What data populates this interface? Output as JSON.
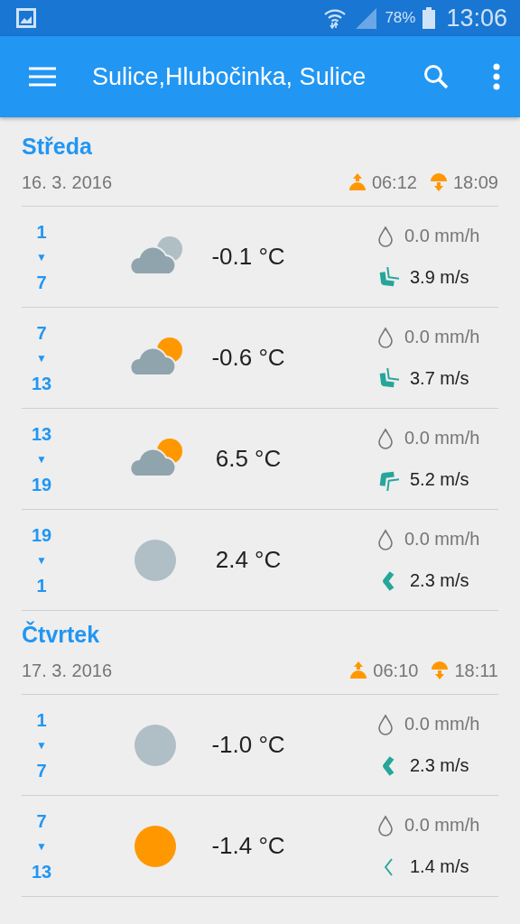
{
  "status_bar": {
    "battery": "78%",
    "time": "13:06"
  },
  "toolbar": {
    "title": "Sulice,Hlubočinka, Sulice"
  },
  "days": [
    {
      "name": "Středa",
      "date": "16. 3. 2016",
      "sunrise": "06:12",
      "sunset": "18:09",
      "rows": [
        {
          "from": "1",
          "arrow": "▼",
          "to": "7",
          "sky": {
            "kind": "cloud-moon"
          },
          "temp": "-0.1 °C",
          "rain": "0.0 mm/h",
          "wind": "3.9 m/s",
          "wind_icon": {
            "kind": "sw-moderate"
          }
        },
        {
          "from": "7",
          "arrow": "▼",
          "to": "13",
          "sky": {
            "kind": "cloud-sun"
          },
          "temp": "-0.6 °C",
          "rain": "0.0 mm/h",
          "wind": "3.7 m/s",
          "wind_icon": {
            "kind": "sw-moderate"
          }
        },
        {
          "from": "13",
          "arrow": "▼",
          "to": "19",
          "sky": {
            "kind": "cloud-sun"
          },
          "temp": "6.5 °C",
          "rain": "0.0 mm/h",
          "wind": "5.2 m/s",
          "wind_icon": {
            "kind": "nw-moderate"
          }
        },
        {
          "from": "19",
          "arrow": "▼",
          "to": "1",
          "sky": {
            "kind": "moon"
          },
          "temp": "2.4 °C",
          "rain": "0.0 mm/h",
          "wind": "2.3 m/s",
          "wind_icon": {
            "kind": "w-fresh"
          }
        }
      ]
    },
    {
      "name": "Čtvrtek",
      "date": "17. 3. 2016",
      "sunrise": "06:10",
      "sunset": "18:11",
      "rows": [
        {
          "from": "1",
          "arrow": "▼",
          "to": "7",
          "sky": {
            "kind": "moon"
          },
          "temp": "-1.0 °C",
          "rain": "0.0 mm/h",
          "wind": "2.3 m/s",
          "wind_icon": {
            "kind": "w-fresh"
          }
        },
        {
          "from": "7",
          "arrow": "▼",
          "to": "13",
          "sky": {
            "kind": "sun"
          },
          "temp": "-1.4 °C",
          "rain": "0.0 mm/h",
          "wind": "1.4 m/s",
          "wind_icon": {
            "kind": "w-light"
          }
        }
      ]
    }
  ]
}
